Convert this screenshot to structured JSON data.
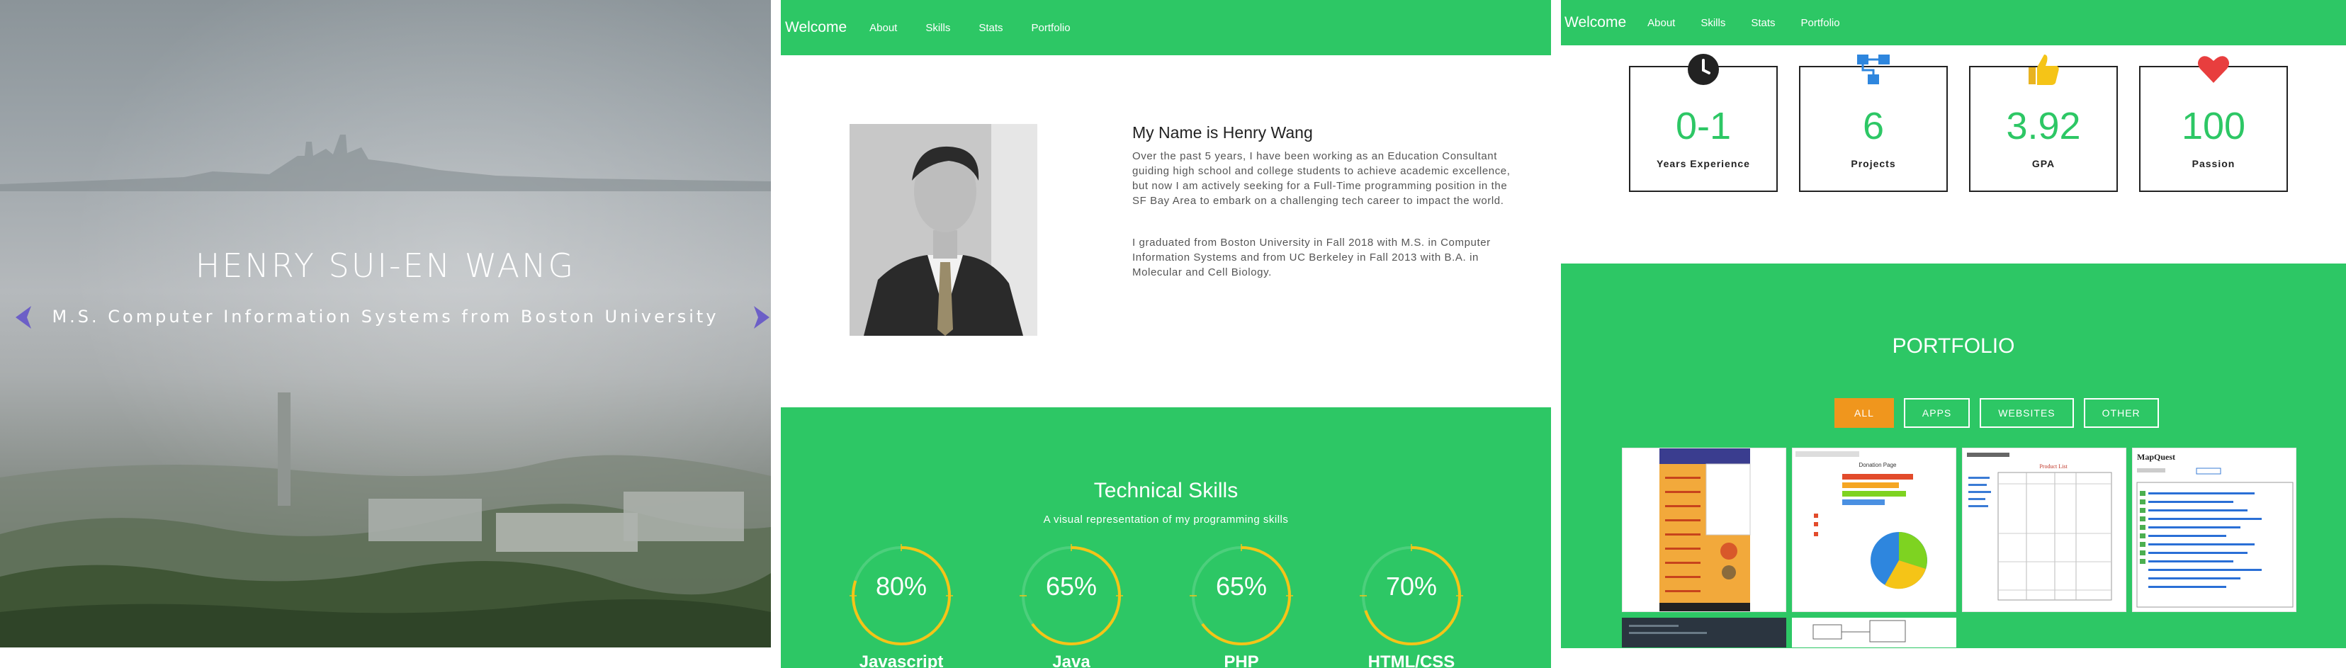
{
  "hero": {
    "title": "HENRY SUI-EN WANG",
    "subtitle": "M.S. Computer Information Systems from Boston University",
    "prev_icon": "chevron-left-icon",
    "next_icon": "chevron-right-icon"
  },
  "nav": {
    "brand": "Welcome",
    "links": [
      "About",
      "Skills",
      "Stats",
      "Portfolio"
    ]
  },
  "about": {
    "title": "My Name is Henry Wang",
    "paragraph1": "Over the past 5 years, I have been working as an Education Consultant guiding high school and college students to achieve academic excellence, but now I am actively seeking for a Full-Time programming position in the SF Bay Area to embark on a challenging tech career to impact the world.",
    "paragraph2": "I graduated from Boston University in Fall 2018 with M.S. in Computer Information Systems and from UC Berkeley in Fall 2013 with B.A. in Molecular and Cell Biology."
  },
  "skills": {
    "title": "Technical Skills",
    "subtitle": "A visual representation of my programming skills",
    "items": [
      {
        "name": "Javascript",
        "percent_label": "80%",
        "percent": 80
      },
      {
        "name": "Java",
        "percent_label": "65%",
        "percent": 65
      },
      {
        "name": "PHP",
        "percent_label": "65%",
        "percent": 65
      },
      {
        "name": "HTML/CSS",
        "percent_label": "70%",
        "percent": 70
      }
    ],
    "ring_color": "#f5c417"
  },
  "stats": [
    {
      "icon": "clock-icon",
      "value": "0-1",
      "label": "Years Experience"
    },
    {
      "icon": "sitemap-icon",
      "value": "6",
      "label": "Projects"
    },
    {
      "icon": "thumbs-up-icon",
      "value": "3.92",
      "label": "GPA"
    },
    {
      "icon": "heart-icon",
      "value": "100",
      "label": "Passion"
    }
  ],
  "portfolio": {
    "title": "PORTFOLIO",
    "filters": [
      "ALL",
      "APPS",
      "WEBSITES",
      "OTHER"
    ],
    "active_filter": "ALL",
    "thumbnails": {
      "donation_title": "Donation Page",
      "product_title": "Product List",
      "mapquest_title": "MapQuest"
    }
  },
  "colors": {
    "green": "#2dc765",
    "orange": "#f0961d",
    "icon_blue": "#2e86de",
    "heart_red": "#e83e3e",
    "thumb_gold": "#f2a93b"
  }
}
